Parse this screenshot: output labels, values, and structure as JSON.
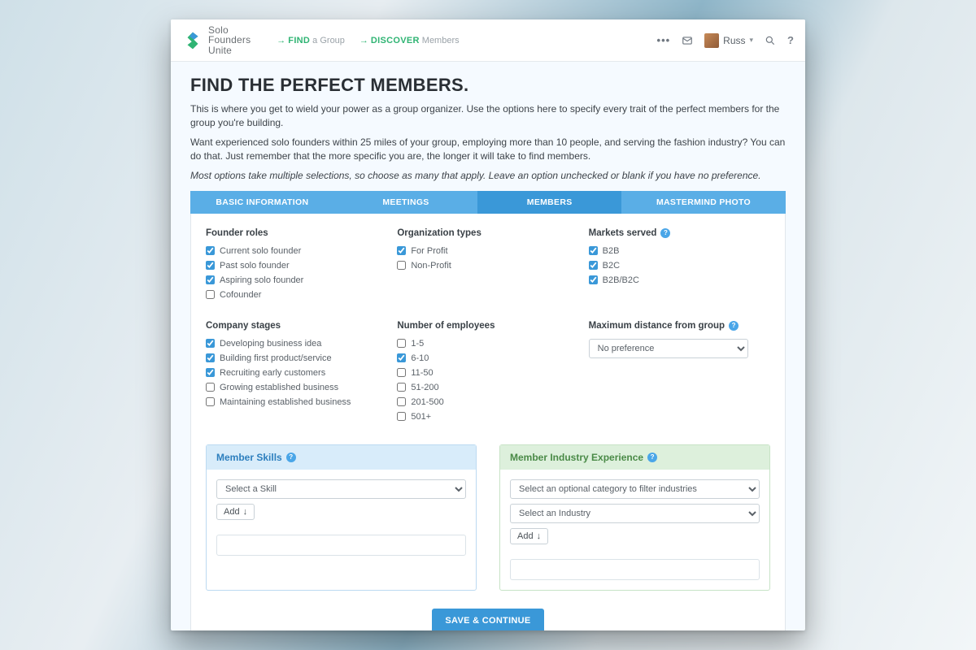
{
  "brand": {
    "l1": "Solo",
    "l2": "Founders",
    "l3": "Unite"
  },
  "nav": {
    "find_strong": "FIND",
    "find_light": "a Group",
    "discover_strong": "DISCOVER",
    "discover_light": "Members"
  },
  "user": {
    "name": "Russ"
  },
  "page": {
    "title": "FIND THE PERFECT MEMBERS.",
    "p1": "This is where you get to wield your power as a group organizer. Use the options here to specify every trait of the perfect members for the group you're building.",
    "p2": "Want experienced solo founders within 25 miles of your group, employing more than 10 people, and serving the fashion industry? You can do that. Just remember that the more specific you are, the longer it will take to find members.",
    "p3": "Most options take multiple selections, so choose as many that apply. Leave an option unchecked or blank if you have no preference."
  },
  "tabs": [
    "BASIC INFORMATION",
    "MEETINGS",
    "MEMBERS",
    "MASTERMIND PHOTO"
  ],
  "active_tab": 2,
  "headings": {
    "founder_roles": "Founder roles",
    "org_types": "Organization types",
    "markets": "Markets served",
    "stages": "Company stages",
    "employees": "Number of employees",
    "distance": "Maximum distance from group"
  },
  "founder_roles": [
    {
      "label": "Current solo founder",
      "checked": true
    },
    {
      "label": "Past solo founder",
      "checked": true
    },
    {
      "label": "Aspiring solo founder",
      "checked": true
    },
    {
      "label": "Cofounder",
      "checked": false
    }
  ],
  "org_types": [
    {
      "label": "For Profit",
      "checked": true
    },
    {
      "label": "Non-Profit",
      "checked": false
    }
  ],
  "markets": [
    {
      "label": "B2B",
      "checked": true
    },
    {
      "label": "B2C",
      "checked": true
    },
    {
      "label": "B2B/B2C",
      "checked": true
    }
  ],
  "stages": [
    {
      "label": "Developing business idea",
      "checked": true
    },
    {
      "label": "Building first product/service",
      "checked": true
    },
    {
      "label": "Recruiting early customers",
      "checked": true
    },
    {
      "label": "Growing established business",
      "checked": false
    },
    {
      "label": "Maintaining established business",
      "checked": false
    }
  ],
  "employees": [
    {
      "label": "1-5",
      "checked": false
    },
    {
      "label": "6-10",
      "checked": true
    },
    {
      "label": "11-50",
      "checked": false
    },
    {
      "label": "51-200",
      "checked": false
    },
    {
      "label": "201-500",
      "checked": false
    },
    {
      "label": "501+",
      "checked": false
    }
  ],
  "distance_select": "No preference",
  "cards": {
    "skills_title": "Member Skills",
    "skills_select": "Select a Skill",
    "industry_title": "Member Industry Experience",
    "industry_cat": "Select an optional category to filter industries",
    "industry_sel": "Select an Industry",
    "add": "Add"
  },
  "save_label": "SAVE & CONTINUE"
}
